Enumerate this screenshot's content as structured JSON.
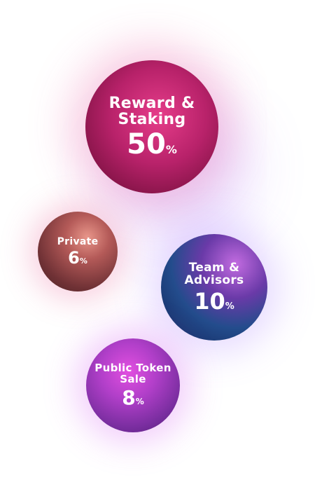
{
  "chart_data": {
    "type": "bubble",
    "unit": "%",
    "items": [
      {
        "id": "reward",
        "label": "Reward & Staking",
        "value": 50,
        "color": "#b8226a"
      },
      {
        "id": "private",
        "label": "Private",
        "value": 6,
        "color": "#8a4545"
      },
      {
        "id": "team",
        "label": "Team & Advisors",
        "value": 10,
        "color": "#234c8c"
      },
      {
        "id": "public",
        "label": "Public Token Sale",
        "value": 8,
        "color": "#9a35b8"
      }
    ],
    "legend": "none",
    "grid": false
  }
}
